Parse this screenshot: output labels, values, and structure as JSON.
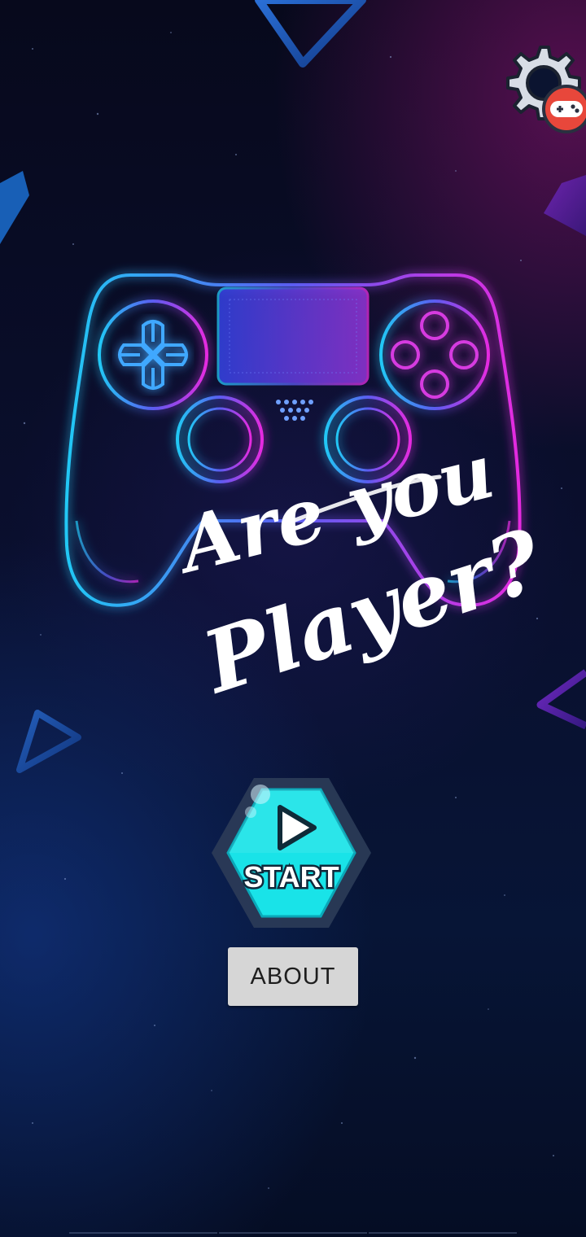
{
  "hero": {
    "tagline_line1": "Are you",
    "tagline_line2": "Player?"
  },
  "settings": {
    "icon": "gear-icon",
    "badge_icon": "gamepad-icon",
    "badge_color": "#e8473b"
  },
  "start_button": {
    "label": "START",
    "icon": "play-icon",
    "color": "#19e3e8"
  },
  "about_button": {
    "label": "ABOUT"
  },
  "colors": {
    "neon_cyan": "#22c8f5",
    "neon_magenta": "#e52be0"
  }
}
